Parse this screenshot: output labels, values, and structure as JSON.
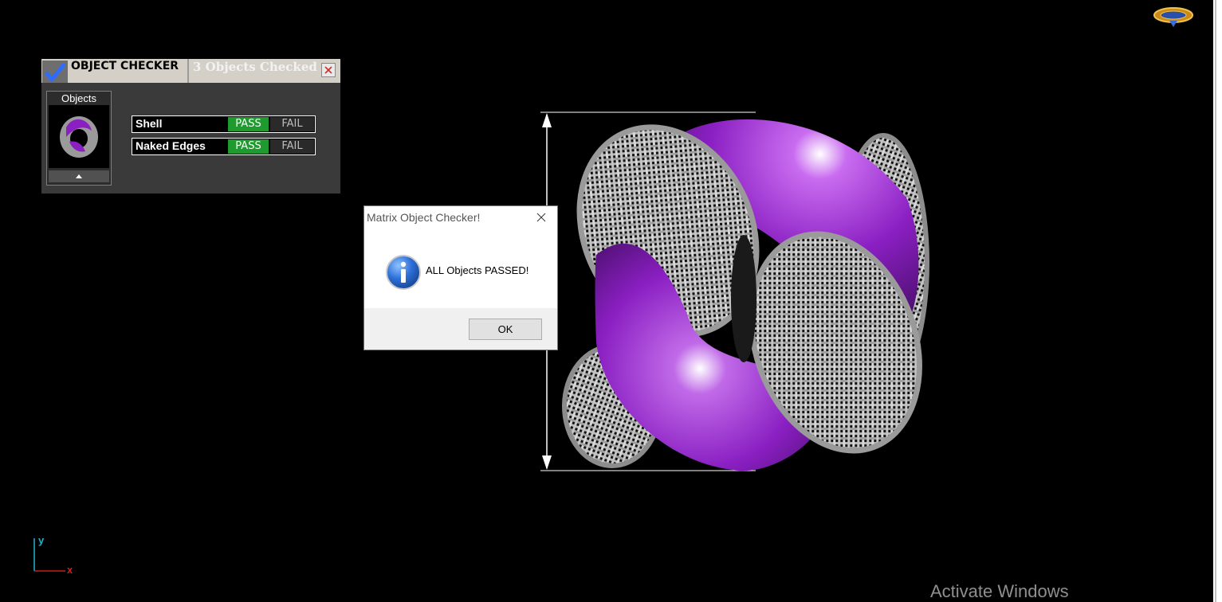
{
  "object_checker": {
    "title": "OBJECT CHECKER",
    "checked_count": "3  Objects Checked",
    "objects_label": "Objects",
    "checks": [
      {
        "label": "Shell",
        "pass": "PASS",
        "fail": "FAIL",
        "result": "PASS"
      },
      {
        "label": "Naked Edges",
        "pass": "PASS",
        "fail": "FAIL",
        "result": "PASS"
      }
    ]
  },
  "dialog": {
    "title": "Matrix Object Checker!",
    "message": "ALL Objects PASSED!",
    "ok_label": "OK"
  },
  "axis": {
    "y": "y",
    "x": "x"
  },
  "watermark": "Activate Windows",
  "colors": {
    "background": "#000000",
    "pass_green": "#1f9a2e",
    "model_purple": "#8a1fc2",
    "model_metal": "#a9a9a9"
  }
}
